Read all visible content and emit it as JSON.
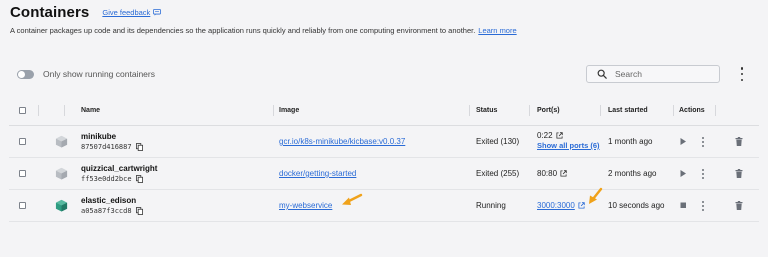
{
  "header": {
    "title": "Containers",
    "feedback_label": "Give feedback",
    "description": "A container packages up code and its dependencies so the application runs quickly and reliably from one computing environment to another.",
    "learn_more": "Learn more"
  },
  "filters": {
    "only_running_label": "Only show running containers",
    "only_running_enabled": false
  },
  "search": {
    "placeholder": "Search",
    "value": ""
  },
  "table": {
    "columns": {
      "name": "Name",
      "image": "Image",
      "status": "Status",
      "ports": "Port(s)",
      "last_started": "Last started",
      "actions": "Actions"
    },
    "rows": [
      {
        "name": "minikube",
        "id": "87507d416887",
        "image": "gcr.io/k8s-minikube/kicbase:v0.0.37",
        "status": "Exited (130)",
        "ports": "0:22",
        "show_all_ports": "Show all ports (6)",
        "last_started": "1 month ago",
        "running": false,
        "icon_color": "#b8bcc2"
      },
      {
        "name": "quizzical_cartwright",
        "id": "ff53e0dd2bce",
        "image": "docker/getting-started",
        "status": "Exited (255)",
        "ports": "80:80",
        "last_started": "2 months ago",
        "running": false,
        "icon_color": "#b8bcc2"
      },
      {
        "name": "elastic_edison",
        "id": "a05a87f3ccd8",
        "image": "my-webservice",
        "status": "Running",
        "ports": "3000:3000",
        "last_started": "10 seconds ago",
        "running": true,
        "icon_color": "#2e9c82"
      }
    ]
  },
  "annotations": {
    "arrow_color": "#f0a21a",
    "arrows": [
      "image-arrow",
      "port-arrow"
    ]
  },
  "colors": {
    "link": "#2a6bd6",
    "running_icon": "#2e9c82",
    "stopped_icon": "#b8bcc2",
    "arrow": "#f0a21a"
  }
}
